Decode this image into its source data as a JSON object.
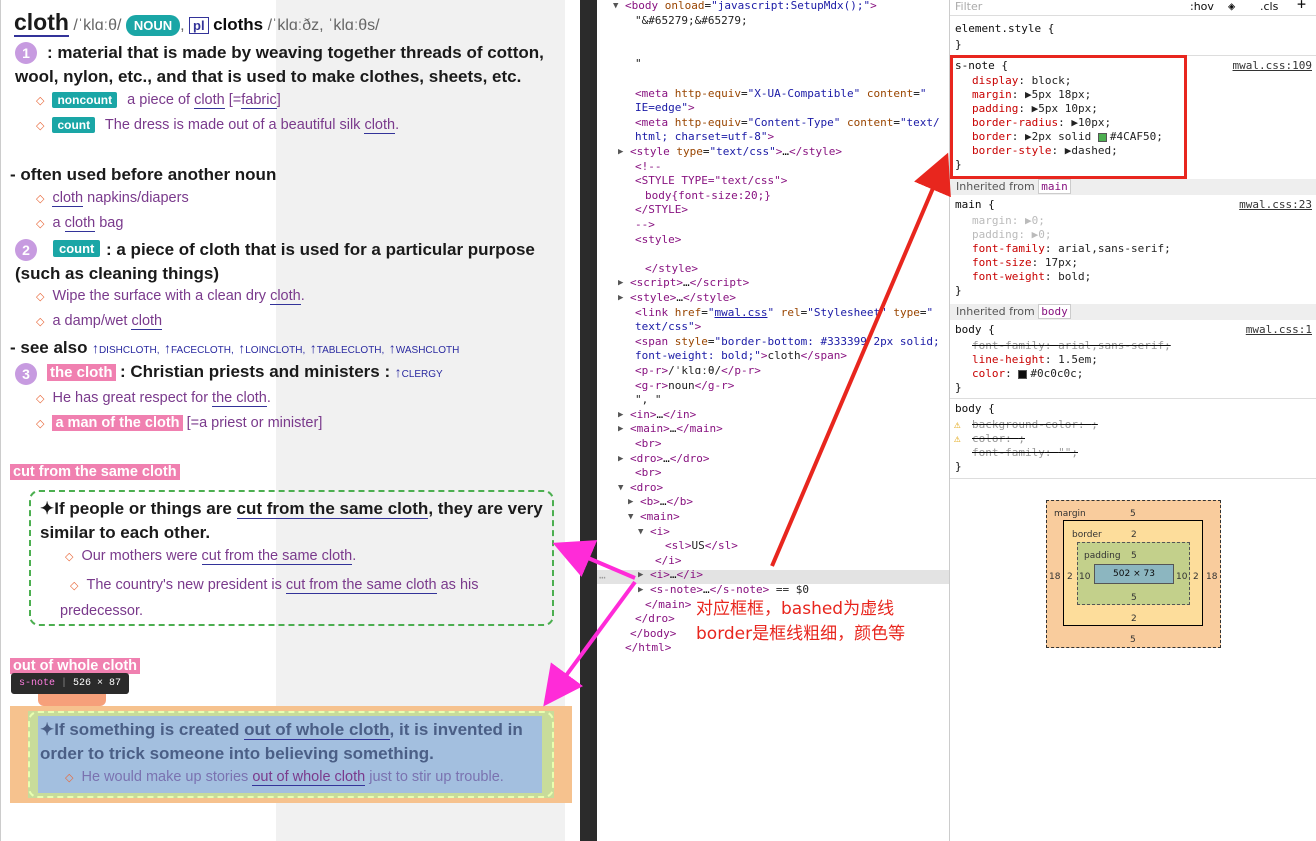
{
  "dict": {
    "headword": "cloth",
    "pron": "/ˈklɑːθ/",
    "pos": "NOUN",
    "plural_tag": "pl",
    "plural_word": "cloths",
    "plural_pron": "/ˈklɑːðz, ˈklɑːθs/",
    "sense1": {
      "num": "1",
      "def": ": material that is made by weaving together threads of cotton, wool, nylon, etc., and that is used to make clothes, sheets, etc.",
      "ex1": {
        "gram": "noncount",
        "pre": "a piece of ",
        "word": "cloth",
        "post": " [=",
        "word2": "fabric",
        "end": "]"
      },
      "ex2": {
        "gram": "count",
        "pre": "The dress is made out of a beautiful silk ",
        "word": "cloth",
        "post": "."
      }
    },
    "noun_note": "- often used before another noun",
    "noun_ex1": {
      "word": "cloth",
      "post": " napkins/diapers"
    },
    "noun_ex2": {
      "pre": "a ",
      "word": "cloth",
      "post": " bag"
    },
    "sense2": {
      "num": "2",
      "gram": "count",
      "def": ": a piece of cloth that is used for a particular purpose (such as cleaning things)",
      "ex1": {
        "pre": "Wipe the surface with a clean dry ",
        "word": "cloth",
        "post": "."
      },
      "ex2": {
        "pre": "a damp/wet ",
        "word": "cloth"
      }
    },
    "see_also": {
      "label": "- see also",
      "links": [
        "DISHCLOTH",
        "FACECLOTH",
        "LOINCLOTH",
        "TABLECLOTH",
        "WASHCLOTH"
      ]
    },
    "sense3": {
      "num": "3",
      "hl": "the cloth",
      "def": ": Christian priests and ministers :",
      "link": "CLERGY",
      "ex1": {
        "pre": "He has great respect for ",
        "word": "the cloth",
        "post": "."
      },
      "ex2": {
        "hl": "a man of the cloth",
        "post": " [=a priest or minister]"
      }
    },
    "phrase1": {
      "title": "cut from the same cloth",
      "def_pre": "✦If people or things are ",
      "def_word": "cut from the same cloth",
      "def_post": ", they are very similar to each other.",
      "ex1": {
        "pre": "Our mothers were ",
        "word": "cut from the same cloth",
        "post": "."
      },
      "ex2": {
        "pre": "The country's new president is ",
        "word": "cut from the same cloth",
        "post": " as his predecessor."
      }
    },
    "phrase2": {
      "title": "out of whole cloth",
      "tooltip_tag": "s-note",
      "tooltip_size": "526 × 87",
      "def_pre": "✦If something is created ",
      "def_word": "out of whole cloth",
      "def_post": ", it is invented in order to trick someone into believing something.",
      "ex1": {
        "pre": "He would make up stories ",
        "word": "out of whole cloth",
        "post": " just to stir up trouble."
      }
    }
  },
  "elements": {
    "lines": [
      {
        "i": 0,
        "tri": "▼",
        "html": "<span class=\"tag\">&lt;body</span> <span class=\"attr\">onload</span>=<span class=\"val\">\"javascript:SetupMdx();\"</span><span class=\"tag\">&gt;</span>"
      },
      {
        "i": 1,
        "html": "<span class=\"txt\">\"&amp;#65279;&amp;#65279;</span>"
      },
      {
        "i": 1,
        "html": ""
      },
      {
        "i": 1,
        "html": ""
      },
      {
        "i": 1,
        "html": "<span class=\"txt\">      \"</span>"
      },
      {
        "i": 1,
        "html": ""
      },
      {
        "i": 1,
        "html": "<span class=\"tag\">&lt;meta</span> <span class=\"attr\">http-equiv</span>=<span class=\"val\">\"X-UA-Compatible\"</span> <span class=\"attr\">content</span>=<span class=\"val\">\"</span>"
      },
      {
        "i": 1,
        "html": "<span class=\"val\">IE=edge\"</span><span class=\"tag\">&gt;</span>"
      },
      {
        "i": 1,
        "html": "<span class=\"tag\">&lt;meta</span> <span class=\"attr\">http-equiv</span>=<span class=\"val\">\"Content-Type\"</span> <span class=\"attr\">content</span>=<span class=\"val\">\"text/</span>"
      },
      {
        "i": 1,
        "html": "<span class=\"val\">html; charset=utf-8\"</span><span class=\"tag\">&gt;</span>"
      },
      {
        "i": 0.5,
        "tri": "▶",
        "html": "<span class=\"tag\">&lt;style</span> <span class=\"attr\">type</span>=<span class=\"val\">\"text/css\"</span><span class=\"tag\">&gt;</span>…<span class=\"tag\">&lt;/style&gt;</span>"
      },
      {
        "i": 1,
        "html": "<span class=\"tag\">&lt;!--</span>"
      },
      {
        "i": 1,
        "html": "<span class=\"tag\">&lt;STYLE TYPE=\"text/css\"&gt;</span>"
      },
      {
        "i": 2,
        "html": "<span class=\"tag\">body{font-size:20;}</span>"
      },
      {
        "i": 1,
        "html": "<span class=\"tag\">&lt;/STYLE&gt;</span>"
      },
      {
        "i": 1,
        "html": "<span class=\"tag\">--&gt;</span>"
      },
      {
        "i": 1,
        "html": "<span class=\"tag\">&lt;style&gt;</span>"
      },
      {
        "i": 1,
        "html": ""
      },
      {
        "i": 2,
        "html": "<span class=\"tag\">&lt;/style&gt;</span>"
      },
      {
        "i": 0.5,
        "tri": "▶",
        "html": "<span class=\"tag\">&lt;script&gt;</span>…<span class=\"tag\">&lt;/script&gt;</span>"
      },
      {
        "i": 0.5,
        "tri": "▶",
        "html": "<span class=\"tag\">&lt;style&gt;</span>…<span class=\"tag\">&lt;/style&gt;</span>"
      },
      {
        "i": 1,
        "html": "<span class=\"tag\">&lt;link</span> <span class=\"attr\">href</span>=<span class=\"val\">\"<span class=\"lnk\">mwal.css</span>\"</span> <span class=\"attr\">rel</span>=<span class=\"val\">\"Stylesheet\"</span> <span class=\"attr\">type</span>=<span class=\"val\">\"</span>"
      },
      {
        "i": 1,
        "html": "<span class=\"val\">text/css\"</span><span class=\"tag\">&gt;</span>"
      },
      {
        "i": 1,
        "html": "<span class=\"tag\">&lt;span</span> <span class=\"attr\">style</span>=<span class=\"val\">\"border-bottom: #333399 2px solid;</span>"
      },
      {
        "i": 1,
        "html": "<span class=\"val\">font-weight: bold;\"</span><span class=\"tag\">&gt;</span><span class=\"txt\">cloth</span><span class=\"tag\">&lt;/span&gt;</span>"
      },
      {
        "i": 1,
        "html": "<span class=\"tag\">&lt;p-r&gt;</span><span class=\"txt\">/ˈklɑːθ/</span><span class=\"tag\">&lt;/p-r&gt;</span>"
      },
      {
        "i": 1,
        "html": "<span class=\"tag\">&lt;g-r&gt;</span><span class=\"txt\">noun</span><span class=\"tag\">&lt;/g-r&gt;</span>"
      },
      {
        "i": 1,
        "html": "<span class=\"txt\">\", \"</span>"
      },
      {
        "i": 0.5,
        "tri": "▶",
        "html": "<span class=\"tag\">&lt;in&gt;</span>…<span class=\"tag\">&lt;/in&gt;</span>"
      },
      {
        "i": 0.5,
        "tri": "▶",
        "html": "<span class=\"tag\">&lt;main&gt;</span>…<span class=\"tag\">&lt;/main&gt;</span>"
      },
      {
        "i": 1,
        "html": "<span class=\"tag\">&lt;br&gt;</span>"
      },
      {
        "i": 0.5,
        "tri": "▶",
        "html": "<span class=\"tag\">&lt;dro&gt;</span>…<span class=\"tag\">&lt;/dro&gt;</span>"
      },
      {
        "i": 1,
        "html": "<span class=\"tag\">&lt;br&gt;</span>"
      },
      {
        "i": 0.5,
        "tri": "▼",
        "html": "<span class=\"tag\">&lt;dro&gt;</span>"
      },
      {
        "i": 1.5,
        "tri": "▶",
        "html": "<span class=\"tag\">&lt;b&gt;</span>…<span class=\"tag\">&lt;/b&gt;</span>"
      },
      {
        "i": 1.5,
        "tri": "▼",
        "html": "<span class=\"tag\">&lt;main&gt;</span>"
      },
      {
        "i": 2.5,
        "tri": "▼",
        "html": "<span class=\"tag\">&lt;i&gt;</span>"
      },
      {
        "i": 4,
        "html": "<span class=\"tag\">&lt;sl&gt;</span><span class=\"txt\">US</span><span class=\"tag\">&lt;/sl&gt;</span>"
      },
      {
        "i": 3,
        "html": "<span class=\"tag\">&lt;/i&gt;</span>"
      },
      {
        "i": 2.5,
        "tri": "▶",
        "html": "<span class=\"tag\">&lt;i&gt;</span>…<span class=\"tag\">&lt;/i&gt;</span>"
      },
      {
        "i": 2.5,
        "tri": "▶",
        "html": "<span class=\"tag\">&lt;s-note&gt;</span>…<span class=\"tag\">&lt;/s-note&gt;</span> <span class=\"txt\">== $0</span>"
      },
      {
        "i": 2,
        "html": "<span class=\"tag\">&lt;/main&gt;</span>"
      },
      {
        "i": 1,
        "html": "<span class=\"tag\">&lt;/dro&gt;</span>"
      },
      {
        "i": 0.5,
        "html": "<span class=\"tag\">&lt;/body&gt;</span>"
      },
      {
        "i": 0,
        "html": "<span class=\"tag\">&lt;/html&gt;</span>"
      }
    ],
    "annotation_line1": "对应框框，bashed为虚线",
    "annotation_line2": "border是框线粗细，颜色等",
    "ellipsis": "⋯"
  },
  "styles": {
    "filter_placeholder": "Filter",
    "hov": ":hov",
    "cls": ".cls",
    "plus": "+",
    "element_style": "element.style {",
    "close": "}",
    "snote_selector": "s-note {",
    "snote_source": "mwal.css:109",
    "snote_props": [
      {
        "p": "display",
        "v": "block;"
      },
      {
        "p": "margin",
        "v": "▶5px 18px;"
      },
      {
        "p": "padding",
        "v": "▶5px 10px;"
      },
      {
        "p": "border-radius",
        "v": "▶10px;"
      },
      {
        "p": "border",
        "v": "▶2px solid ",
        "swatch": "#4CAF50",
        "v2": "#4CAF50;"
      },
      {
        "p": "border-style",
        "v": "▶dashed;"
      }
    ],
    "inherited_main_label": "Inherited from",
    "inherited_main_tag": "main",
    "main_selector": "main {",
    "main_source": "mwal.css:23",
    "main_props": [
      {
        "p": "margin",
        "v": "▶0;",
        "dim": true
      },
      {
        "p": "padding",
        "v": "▶0;",
        "dim": true
      },
      {
        "p": "font-family",
        "v": "arial,sans-serif;"
      },
      {
        "p": "font-size",
        "v": "17px;"
      },
      {
        "p": "font-weight",
        "v": "bold;"
      }
    ],
    "inherited_body_label": "Inherited from",
    "inherited_body_tag": "body",
    "body_selector": "body {",
    "body_source": "mwal.css:1",
    "body_props": [
      {
        "p": "font-family",
        "v": "arial,sans-serif;",
        "strike": true
      },
      {
        "p": "line-height",
        "v": "1.5em;"
      },
      {
        "p": "color",
        "v": "#0c0c0c;",
        "swatch": "#0c0c0c"
      }
    ],
    "body2_selector": "body {",
    "body2_props": [
      {
        "p": "background-color",
        "v": ";",
        "warn": true
      },
      {
        "p": "color",
        "v": ";",
        "warn": true
      },
      {
        "p": "font-family",
        "v": "\"\";",
        "strike": true
      }
    ],
    "boxmodel": {
      "margin_label": "margin",
      "border_label": "border",
      "padding_label": "padding",
      "margin": {
        "top": "5",
        "bottom": "5",
        "left": "18",
        "right": "18"
      },
      "border": {
        "top": "2",
        "bottom": "2",
        "left": "2",
        "right": "2"
      },
      "padding": {
        "top": "5",
        "bottom": "5",
        "left": "10",
        "right": "10"
      },
      "content": "502 × 73"
    }
  },
  "colors": {
    "accent_green": "#4CAF50",
    "annotation_red": "#e8261e",
    "magenta_arrow": "#ff2bd8",
    "teal_pill": "#1aa6a6",
    "pink_highlight": "#f080b0"
  }
}
